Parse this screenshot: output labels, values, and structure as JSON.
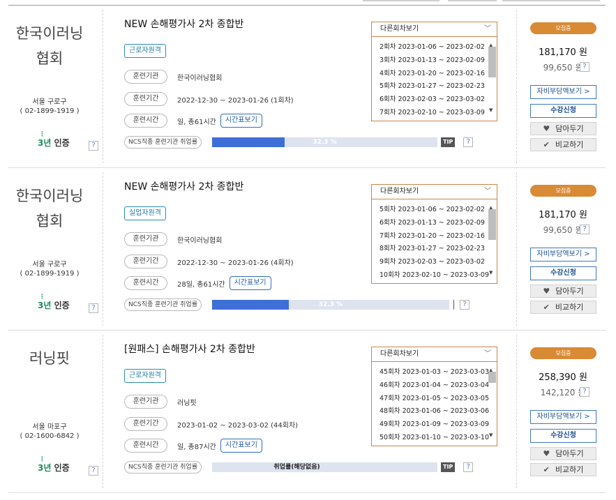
{
  "colors": {
    "accent": "#3e6fd6",
    "status": "#d98a34",
    "session_border": "#c7874b",
    "badge": "#2b8bb3"
  },
  "courses": [
    {
      "institution": [
        "한국이러닝",
        "협회"
      ],
      "location": "서울 구로구",
      "phone": "( 02-1899-1919 )",
      "cert_num": "3년",
      "cert_label": "인증",
      "title": "NEW 손해평가사 2차 종합반",
      "badge": "근로자원격",
      "labels": {
        "org": "훈련기관",
        "period": "훈련기간",
        "hours": "훈련시간",
        "ncs": "NCS직종 훈련기관 취업률"
      },
      "org": "한국이러닝협회",
      "period": "2022-12-30 ~ 2023-01-26 (1회차)",
      "hours": "일, 총61시간",
      "timetable_btn": "시간표보기",
      "employment": "32.3 %",
      "employment_fraction": 0.323,
      "tip": "TIP",
      "help": "?",
      "session_head": "다른회차보기",
      "sessions": [
        "2회차 2023-01-06 ~ 2023-02-02",
        "3회차 2023-01-13 ~ 2023-02-09",
        "4회차 2023-01-20 ~ 2023-02-16",
        "5회차 2023-01-27 ~ 2023-02-23",
        "6회차 2023-02-03 ~ 2023-03-02",
        "7회차 2023-02-10 ~ 2023-03-09"
      ],
      "status": "모집중",
      "price": "181,170 원",
      "discount": "99,650 원",
      "buttons": {
        "self_pay": "자비부담액보기 >",
        "enroll": "수강신청",
        "wishlist": "담아두기",
        "compare": "비교하기"
      }
    },
    {
      "institution": [
        "한국이러닝",
        "협회"
      ],
      "location": "서울 구로구",
      "phone": "( 02-1899-1919 )",
      "cert_num": "3년",
      "cert_label": "인증",
      "title": "NEW 손해평가사 2차 종합반",
      "badge": "실업자원격",
      "labels": {
        "org": "훈련기관",
        "period": "훈련기간",
        "hours": "훈련시간",
        "ncs": "NCS직종 훈련기관 취업률"
      },
      "org": "한국이러닝협회",
      "period": "2022-12-30 ~ 2023-01-26 (4회차)",
      "hours": "28일, 총61시간",
      "timetable_btn": "시간표보기",
      "employment": "32.3 %",
      "employment_fraction": 0.323,
      "tip": "",
      "help": "?",
      "session_head": "다른회차보기",
      "sessions": [
        "5회차 2023-01-06 ~ 2023-02-02",
        "6회차 2023-01-13 ~ 2023-02-09",
        "7회차 2023-01-20 ~ 2023-02-16",
        "8회차 2023-01-27 ~ 2023-02-23",
        "9회차 2023-02-03 ~ 2023-03-02",
        "10회차 2023-02-10 ~ 2023-03-09"
      ],
      "status": "모집중",
      "price": "181,170 원",
      "discount": "99,650 원",
      "buttons": {
        "self_pay": "자비부담액보기 >",
        "enroll": "수강신청",
        "wishlist": "담아두기",
        "compare": "비교하기"
      }
    },
    {
      "institution": [
        "러닝핏",
        ""
      ],
      "location": "서울 마포구",
      "phone": "( 02-1600-6842 )",
      "cert_num": "3년",
      "cert_label": "인증",
      "title": "[원패스] 손해평가사 2차 종합반",
      "badge": "근로자원격",
      "labels": {
        "org": "훈련기관",
        "period": "훈련기간",
        "hours": "훈련시간",
        "ncs": "NCS직종 훈련기관 취업률"
      },
      "org": "러닝핏",
      "period": "2023-01-02 ~ 2023-03-02 (44회차)",
      "hours": "일, 총87시간",
      "timetable_btn": "시간표보기",
      "employment": "취업률(해당없음)",
      "employment_fraction": 0,
      "tip": "TIP",
      "help": "?",
      "session_head": "다른회차보기",
      "sessions": [
        "45회차 2023-01-03 ~ 2023-03-03",
        "46회차 2023-01-04 ~ 2023-03-04",
        "47회차 2023-01-05 ~ 2023-03-05",
        "48회차 2023-01-06 ~ 2023-03-06",
        "49회차 2023-01-09 ~ 2023-03-09",
        "50회차 2023-01-10 ~ 2023-03-10"
      ],
      "status": "모집중",
      "price": "258,390 원",
      "discount": "142,120 원",
      "buttons": {
        "self_pay": "자비부담액보기 >",
        "enroll": "수강신청",
        "wishlist": "담아두기",
        "compare": "비교하기"
      }
    }
  ]
}
